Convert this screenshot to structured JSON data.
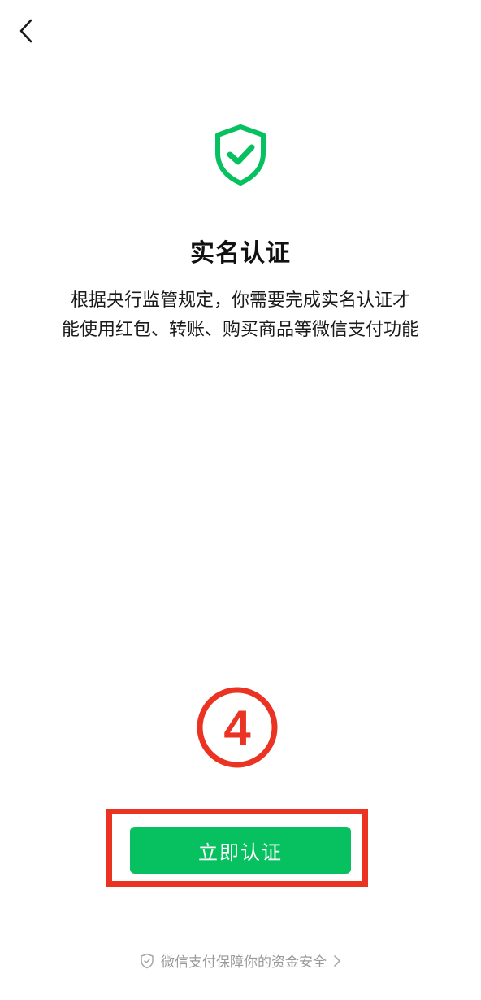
{
  "header": {
    "back_icon": "chevron-left-icon"
  },
  "hero": {
    "icon": "shield-check-icon",
    "title": "实名认证",
    "description_line1": "根据央行监管规定，你需要完成实名认证才",
    "description_line2": "能使用红包、转账、购买商品等微信支付功能"
  },
  "annotation": {
    "step_number": "4",
    "marker_color": "#ea3323"
  },
  "action": {
    "confirm_label": "立即认证",
    "button_color": "#07c160"
  },
  "footer": {
    "icon": "shield-outline-icon",
    "text": "微信支付保障你的资金安全",
    "chevron_icon": "chevron-right-icon"
  },
  "colors": {
    "brand_green": "#07c160",
    "annotation_red": "#ea3323"
  }
}
